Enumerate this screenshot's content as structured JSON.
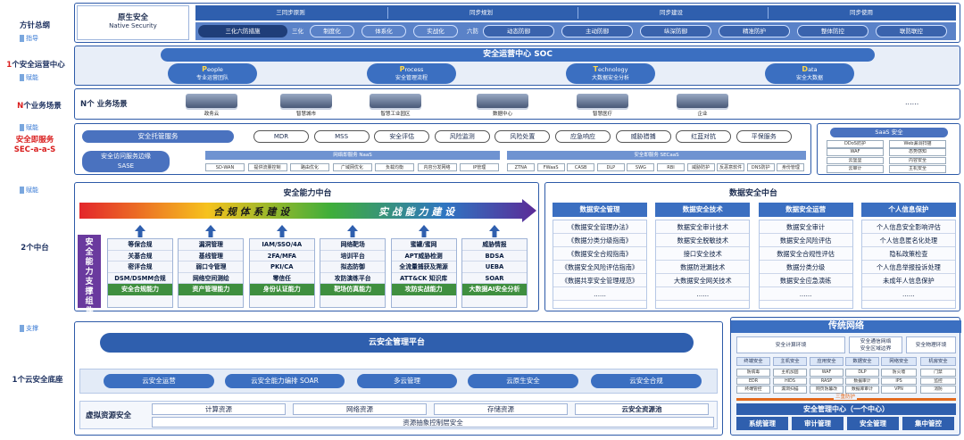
{
  "left_labels": {
    "l1": "方针总纲",
    "l1_sub": "指导",
    "l2_num": "1",
    "l2": "个安全运营中心",
    "l2_sub": "赋能",
    "l3_num": "N",
    "l3": "个业务场景",
    "l3_sub": "赋能",
    "l4_a": "安全即服务",
    "l4_b": "SEC-a-a-S",
    "l4_sub": "赋能",
    "l5": "2个中台",
    "l6_sub": "支撑",
    "l7": "1个云安全底座"
  },
  "top": {
    "native_cn": "原生安全",
    "native_en": "Native Security",
    "row1": [
      "三同步原则",
      "同步规划",
      "同步建设",
      "同步使用"
    ],
    "row2_lead": "三化六防措施",
    "row2_prefix1": "三化",
    "row2": [
      "制度化",
      "体系化",
      "实战化"
    ],
    "row2_prefix2": "六防",
    "row2b": [
      "动态防御",
      "主动防御",
      "纵深防御",
      "精准防护",
      "整体防控",
      "联防联控"
    ]
  },
  "soc": {
    "title": "安全运营中心 SOC",
    "ppt": [
      {
        "letter": "P",
        "rest": "eople",
        "cn": "专业运营团队"
      },
      {
        "letter": "P",
        "rest": "rocess",
        "cn": "安全管理流程"
      },
      {
        "letter": "T",
        "rest": "echnology",
        "cn": "大数据安全分析"
      },
      {
        "letter": "D",
        "rest": "ata",
        "cn": "安全大数据"
      }
    ]
  },
  "scenes": {
    "title": "N个 业务场景",
    "items": [
      "政务云",
      "智慧城市",
      "智慧工业园区",
      "数据中心",
      "智慧医疗",
      "企业"
    ],
    "more": "......"
  },
  "services": {
    "managed_label": "安全托管服务",
    "managed": [
      "MDR",
      "MSS",
      "安全评估",
      "风险监测",
      "风险处置",
      "应急响应",
      "威胁猎捕",
      "红蓝对抗",
      "平保服务"
    ],
    "sase_label_1": "安全访问服务边缘",
    "sase_label_2": "SASE",
    "net_title": "网络即服务 NaaS",
    "net_items": [
      "SD-WAN",
      "提供流量控制",
      "路由优化",
      "广域网优化",
      "负载均衡",
      "内容分发网络",
      "IP管理"
    ],
    "sec_title": "安全即服务 SECaaS",
    "sec_items": [
      "ZTNA",
      "FWaaS",
      "CASB",
      "DLP",
      "SWG",
      "RBI",
      "威胁防护",
      "反恶意软件",
      "DNS防护",
      "身份管理"
    ],
    "saas_title": "SaaS 安全",
    "saas_items": [
      "DDoS防护",
      "Web漏洞扫描",
      "WAF",
      "态势感知",
      "云堡垒",
      "内容安全",
      "云审计",
      "主机安全"
    ]
  },
  "capability": {
    "title": "安全能力中台",
    "arrow_left": "合 规 体 系 建 设",
    "arrow_right": "实 战 能 力 建 设",
    "side_label": "安全能力支撑组件",
    "columns": [
      {
        "items": [
          "等保合规",
          "关基合规",
          "密评合规",
          "DSM/DSMM合规"
        ],
        "foot": "安全合规能力"
      },
      {
        "items": [
          "漏洞管理",
          "基线管理",
          "弱口令管理",
          "网络空间测绘"
        ],
        "foot": "资产管理能力"
      },
      {
        "items": [
          "IAM/SSO/4A",
          "2FA/MFA",
          "PKI/CA",
          "零信任"
        ],
        "foot": "身份认证能力"
      },
      {
        "items": [
          "网络靶场",
          "培训平台",
          "拟态防御",
          "攻防演练平台"
        ],
        "foot": "靶场仿真能力"
      },
      {
        "items": [
          "蜜罐/蜜网",
          "APT威胁检测",
          "全流量捕获及溯源",
          "ATT&CK 知识库"
        ],
        "foot": "攻防实战能力"
      },
      {
        "items": [
          "威胁情报",
          "BDSA",
          "UEBA",
          "SOAR"
        ],
        "foot": "大数据AI安全分析"
      }
    ]
  },
  "data_platform": {
    "title": "数据安全中台",
    "columns": [
      {
        "head": "数据安全管理",
        "items": [
          "《数据安全管理办法》",
          "《数据分类分级指南》",
          "《数据安全合规指南》",
          "《数据安全风险评估指南》",
          "《数据共享安全管理规范》",
          "......"
        ]
      },
      {
        "head": "数据安全技术",
        "items": [
          "数据安全审计技术",
          "数据安全脱敏技术",
          "接口安全技术",
          "数据防泄漏技术",
          "大数据安全网关技术",
          "......"
        ]
      },
      {
        "head": "数据安全运营",
        "items": [
          "数据安全审计",
          "数据安全风险评估",
          "数据安全合规性评估",
          "数据分类分级",
          "数据安全应急演练",
          "......"
        ]
      },
      {
        "head": "个人信息保护",
        "items": [
          "个人信息安全影响评估",
          "个人信息匿名化处理",
          "隐私政策检查",
          "个人信息举报投诉处理",
          "未成年人信息保护",
          "......"
        ]
      }
    ]
  },
  "cloud_base": {
    "platform": "云安全管理平台",
    "row": [
      "云安全运营",
      "云安全能力编排 SOAR",
      "多云管理",
      "云原生安全",
      "云安全合规"
    ],
    "virt_label": "虚拟资源安全",
    "virt": [
      "计算资源",
      "网络资源",
      "存储资源",
      "云安全资源池"
    ],
    "virt_foot": "资源抽象控制层安全"
  },
  "traditional": {
    "title": "传统网络",
    "top_row": [
      "安全计算环境",
      "安全通信网络\n安全区域边界",
      "安全物理环境"
    ],
    "sub_heads": [
      "终端安全",
      "主机安全",
      "应用安全",
      "数据安全",
      "网络安全",
      "机房安全"
    ],
    "small": [
      "防病毒",
      "主机加固",
      "WAF",
      "DLP",
      "防火墙",
      "门禁",
      "EDR",
      "HIDS",
      "RASP",
      "数据审计",
      "IPS",
      "监控",
      "终端管控",
      "漏洞扫描",
      "网页防篡改",
      "数据库审计",
      "VPN",
      "消防"
    ],
    "bar_label": "三重防护",
    "center": "安全管理中心（一个中心）",
    "bottom": [
      "系统管理",
      "审计管理",
      "安全管理",
      "集中管控"
    ]
  }
}
